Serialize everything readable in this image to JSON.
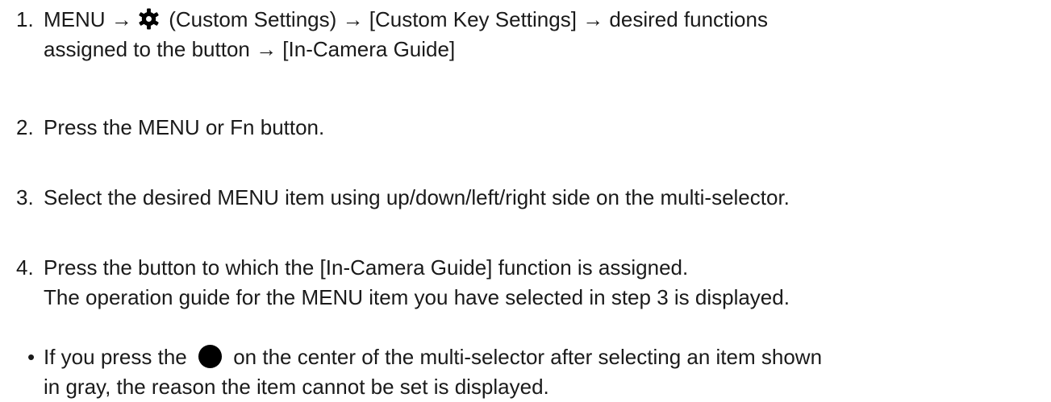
{
  "steps": [
    {
      "number": "1.",
      "text_before_icon": "MENU → ",
      "icon": "gear-icon",
      "text_after_icon": " (Custom Settings) → [Custom Key Settings] → desired functions",
      "line2": "assigned to the button → [In-Camera Guide]"
    },
    {
      "number": "2.",
      "text": "Press the MENU or Fn button."
    },
    {
      "number": "3.",
      "text": "Select the desired MENU item using up/down/left/right side on the multi-selector."
    },
    {
      "number": "4.",
      "line1": "Press the button to which the [In-Camera Guide] function is assigned.",
      "line2": "The operation guide for the MENU item you have selected in step 3 is displayed."
    }
  ],
  "note": {
    "bullet": "•",
    "text_before_icon": "If you press the ",
    "icon": "center-button-icon",
    "text_after_icon": " on the center of the multi-selector after selecting an item shown",
    "line2": "in gray, the reason the item cannot be set is displayed."
  },
  "colors": {
    "text": "#1a1a1a",
    "icon": "#000000"
  }
}
